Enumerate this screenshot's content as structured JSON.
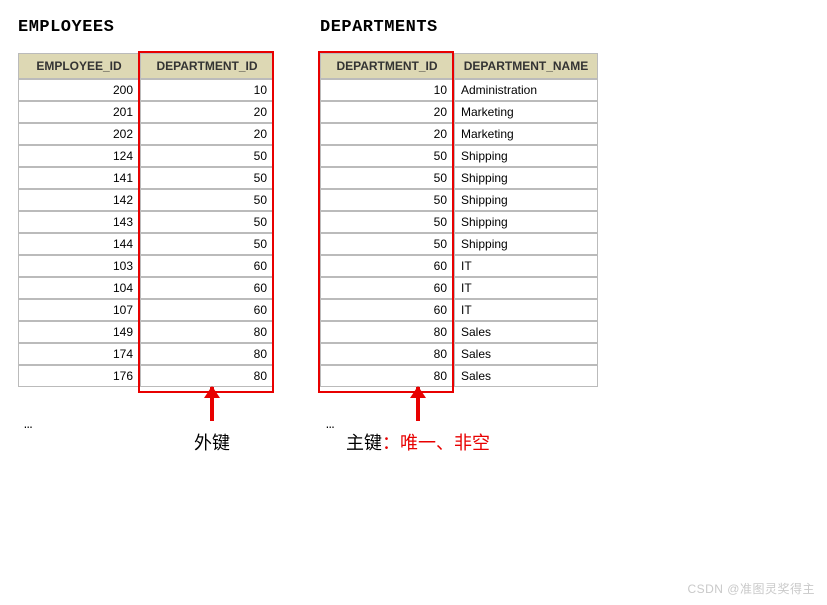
{
  "employees": {
    "title": "EMPLOYEES",
    "headers": {
      "id": "EMPLOYEE_ID",
      "dept": "DEPARTMENT_ID"
    },
    "rows": [
      {
        "id": "200",
        "dept": "10"
      },
      {
        "id": "201",
        "dept": "20"
      },
      {
        "id": "202",
        "dept": "20"
      },
      {
        "id": "124",
        "dept": "50"
      },
      {
        "id": "141",
        "dept": "50"
      },
      {
        "id": "142",
        "dept": "50"
      },
      {
        "id": "143",
        "dept": "50"
      },
      {
        "id": "144",
        "dept": "50"
      },
      {
        "id": "103",
        "dept": "60"
      },
      {
        "id": "104",
        "dept": "60"
      },
      {
        "id": "107",
        "dept": "60"
      },
      {
        "id": "149",
        "dept": "80"
      },
      {
        "id": "174",
        "dept": "80"
      },
      {
        "id": "176",
        "dept": "80"
      }
    ],
    "ellipsis": "…",
    "annotation": "外键"
  },
  "departments": {
    "title": "DEPARTMENTS",
    "headers": {
      "id": "DEPARTMENT_ID",
      "name": "DEPARTMENT_NAME"
    },
    "rows": [
      {
        "id": "10",
        "name": "Administration"
      },
      {
        "id": "20",
        "name": "Marketing"
      },
      {
        "id": "20",
        "name": "Marketing"
      },
      {
        "id": "50",
        "name": "Shipping"
      },
      {
        "id": "50",
        "name": "Shipping"
      },
      {
        "id": "50",
        "name": "Shipping"
      },
      {
        "id": "50",
        "name": "Shipping"
      },
      {
        "id": "50",
        "name": "Shipping"
      },
      {
        "id": "60",
        "name": "IT"
      },
      {
        "id": "60",
        "name": "IT"
      },
      {
        "id": "60",
        "name": "IT"
      },
      {
        "id": "80",
        "name": "Sales"
      },
      {
        "id": "80",
        "name": "Sales"
      },
      {
        "id": "80",
        "name": "Sales"
      }
    ],
    "ellipsis": "…",
    "annotation_main": "主键",
    "annotation_extra": "：唯一、非空"
  },
  "watermark": "CSDN @准图灵奖得主"
}
